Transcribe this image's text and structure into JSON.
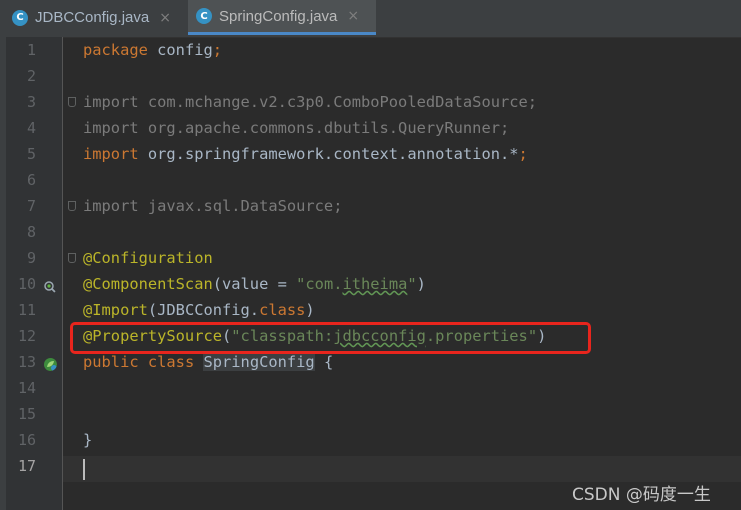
{
  "tabs": [
    {
      "label": "JDBCConfig.java",
      "icon": "c-class-icon",
      "close": "×"
    },
    {
      "label": "SpringConfig.java",
      "icon": "c-class-icon",
      "close": "×"
    }
  ],
  "line_numbers": [
    "1",
    "2",
    "3",
    "4",
    "5",
    "6",
    "7",
    "8",
    "9",
    "10",
    "11",
    "12",
    "13",
    "14",
    "15",
    "16",
    "17"
  ],
  "code": {
    "l1_kw": "package",
    "l1_rest": " config",
    "l1_semi": ";",
    "l3_kw": "import",
    "l3_rest": " com.mchange.v2.c3p0.ComboPooledDataSource;",
    "l4_kw": "import",
    "l4_rest": " org.apache.commons.dbutils.QueryRunner;",
    "l5_kw": "import",
    "l5_rest": " org.springframework.context.annotation.*",
    "l5_semi": ";",
    "l7_kw": "import",
    "l7_rest": " javax.sql.DataSource;",
    "l9_ann": "@Configuration",
    "l10_ann": "@ComponentScan",
    "l10_a": "(value = ",
    "l10_str1": "\"com.",
    "l10_str2": "itheima",
    "l10_str3": "\"",
    "l10_b": ")",
    "l11_ann": "@Import",
    "l11_a": "(JDBCConfig.",
    "l11_kw": "class",
    "l11_b": ")",
    "l12_ann": "@PropertySource",
    "l12_a": "(",
    "l12_str1": "\"classpath:",
    "l12_str2": "jdbcconfig",
    "l12_str3": ".properties\"",
    "l12_b": ")",
    "l13_kw1": "public",
    "l13_kw2": " class ",
    "l13_name": "SpringConfig",
    "l13_b": " {",
    "l16": "}"
  },
  "watermark": "CSDN @码度一生",
  "colors": {
    "keyword": "#cc7832",
    "annotation": "#bbb529",
    "string": "#6a8759",
    "highlight_box": "#e8251d"
  }
}
